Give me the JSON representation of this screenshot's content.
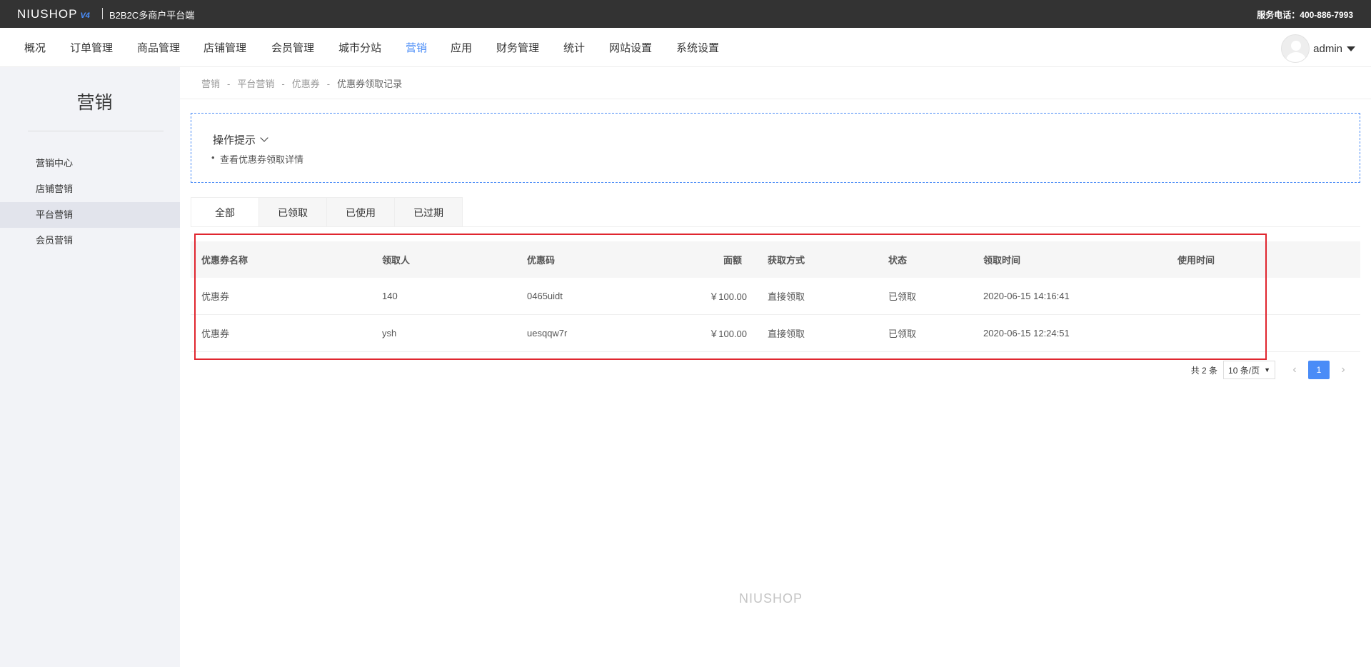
{
  "topbar": {
    "logo": "NIUSHOP",
    "logo_version": "V4",
    "platform": "B2B2C多商户平台端",
    "service_phone": "服务电话：400-886-7993"
  },
  "nav": {
    "items": [
      "概况",
      "订单管理",
      "商品管理",
      "店铺管理",
      "会员管理",
      "城市分站",
      "营销",
      "应用",
      "财务管理",
      "统计",
      "网站设置",
      "系统设置"
    ],
    "active": "营销",
    "user": "admin"
  },
  "sidebar": {
    "title": "营销",
    "items": [
      "营销中心",
      "店铺营销",
      "平台营销",
      "会员营销"
    ],
    "active": "平台营销"
  },
  "breadcrumb": {
    "items": [
      "营销",
      "平台营销",
      "优惠券"
    ],
    "current": "优惠券领取记录",
    "separator": "-"
  },
  "tips": {
    "title": "操作提示",
    "items": [
      "查看优惠券领取详情"
    ]
  },
  "tabs": [
    "全部",
    "已领取",
    "已使用",
    "已过期"
  ],
  "table": {
    "headers": [
      "优惠券名称",
      "领取人",
      "优惠码",
      "面额",
      "获取方式",
      "状态",
      "领取时间",
      "使用时间"
    ],
    "rows": [
      [
        "优惠券",
        "140",
        "0465uidt",
        "￥100.00",
        "直接领取",
        "已领取",
        "2020-06-15 14:16:41",
        ""
      ],
      [
        "优惠券",
        "ysh",
        "uesqqw7r",
        "￥100.00",
        "直接领取",
        "已领取",
        "2020-06-15 12:24:51",
        ""
      ]
    ]
  },
  "pager": {
    "total": "共 2 条",
    "page_size": "10 条/页",
    "current_page": "1",
    "prev": "‹",
    "next": "›"
  },
  "footer": {
    "logo": "NIUSHOP"
  },
  "colors": {
    "accent": "#4a8cf7",
    "highlight": "#e0262f",
    "topbar": "#333333"
  }
}
